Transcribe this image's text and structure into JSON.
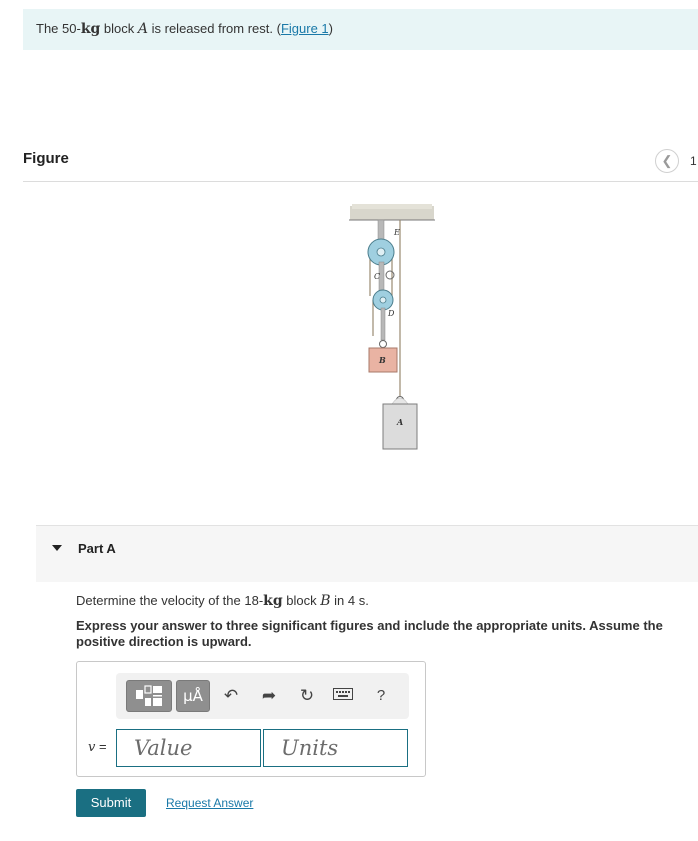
{
  "intro": {
    "prefix": "The 50-",
    "unit": "kg",
    "middle": " block ",
    "block_var": "A",
    "suffix": " is released from rest. (",
    "figure_link": "Figure 1",
    "close": ")"
  },
  "figure": {
    "title": "Figure",
    "page_number": "1",
    "prev_icon": "chevron-left-icon",
    "labels": {
      "e": "E",
      "c": "C",
      "d": "D",
      "b": "B",
      "a": "A"
    }
  },
  "part": {
    "label": "Part A",
    "question": {
      "prefix": "Determine the velocity of the 18-",
      "unit": "kg",
      "middle": " block ",
      "block_var": "B",
      "suffix": " in 4 s."
    },
    "instruction": "Express your answer to three significant figures and include the appropriate units. Assume the positive direction is upward."
  },
  "answer": {
    "variable": "v",
    "equals": " =",
    "value_placeholder": "Value",
    "units_placeholder": "Units",
    "units_button": "μÅ",
    "help": "?",
    "icons": {
      "templates": "templates-icon",
      "units": "units-icon",
      "undo": "undo-icon",
      "redo": "redo-icon",
      "reset": "reset-icon",
      "keyboard": "keyboard-icon",
      "help": "help-icon"
    }
  },
  "actions": {
    "submit": "Submit",
    "request_answer": "Request Answer"
  },
  "colors": {
    "banner": "#e8f5f6",
    "link": "#1a79a8",
    "primary_button": "#1a6f82",
    "pulley": "#9fcfe0",
    "block_b": "#e9b3a3",
    "block_a": "#dcdcdc"
  }
}
